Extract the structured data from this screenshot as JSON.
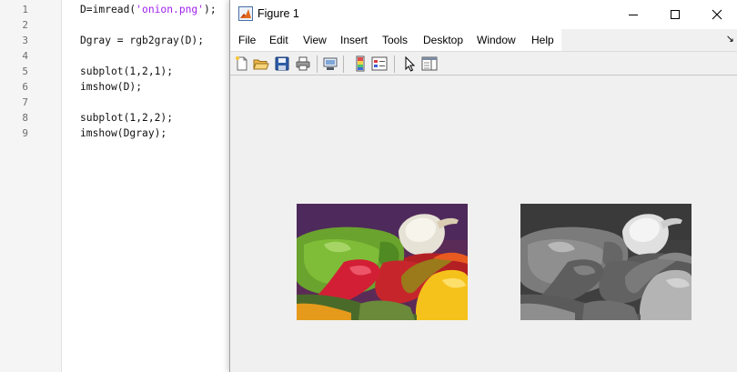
{
  "editor": {
    "line_numbers": [
      "1",
      "2",
      "3",
      "4",
      "5",
      "6",
      "7",
      "8",
      "9"
    ],
    "lines": [
      {
        "pre": "D=imread(",
        "str": "'onion.png'",
        "post": ");"
      },
      {
        "pre": "",
        "str": "",
        "post": ""
      },
      {
        "pre": "Dgray = rgb2gray(D);",
        "str": "",
        "post": ""
      },
      {
        "pre": "",
        "str": "",
        "post": ""
      },
      {
        "pre": "subplot(1,2,1);",
        "str": "",
        "post": ""
      },
      {
        "pre": "imshow(D);",
        "str": "",
        "post": ""
      },
      {
        "pre": "",
        "str": "",
        "post": ""
      },
      {
        "pre": "subplot(1,2,2);",
        "str": "",
        "post": ""
      },
      {
        "pre": "imshow(Dgray);",
        "str": "",
        "post": ""
      }
    ],
    "string_color": "#a020f0"
  },
  "figure": {
    "title": "Figure 1",
    "icon": "matlab-figure-icon",
    "window_buttons": [
      "minimize-icon",
      "maximize-icon",
      "close-icon"
    ],
    "menu": [
      "File",
      "Edit",
      "View",
      "Insert",
      "Tools",
      "Desktop",
      "Window",
      "Help"
    ],
    "menu_overflow_glyph": "↘",
    "toolbar": [
      "new-figure-icon",
      "open-file-icon",
      "save-icon",
      "print-icon",
      "link-plot-icon",
      "colorbar-icon",
      "legend-icon",
      "edit-plot-icon",
      "property-inspector-icon"
    ],
    "subplots": [
      {
        "name": "color-image",
        "source": "D"
      },
      {
        "name": "grayscale-image",
        "source": "Dgray"
      }
    ]
  }
}
